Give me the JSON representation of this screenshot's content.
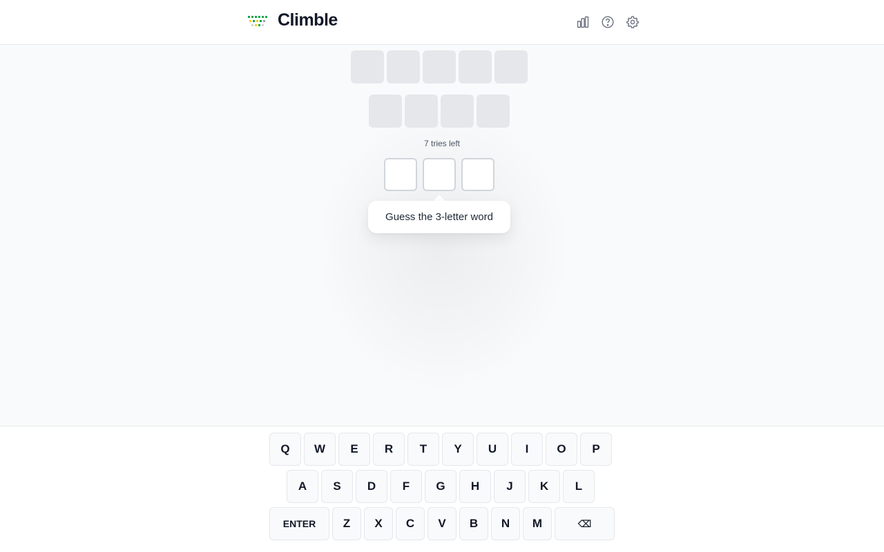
{
  "header": {
    "title": "Climble",
    "logo_icon": "climble-logo-icon",
    "icons": [
      "stats-icon",
      "help-icon",
      "settings-icon"
    ]
  },
  "board": {
    "completed_rows": [
      {
        "length": 5,
        "letters": [
          "",
          "",
          "",
          "",
          ""
        ]
      },
      {
        "length": 4,
        "letters": [
          "",
          "",
          "",
          ""
        ]
      }
    ],
    "tries_left": "7 tries left",
    "current_row": {
      "length": 3,
      "letters": [
        "",
        "",
        ""
      ]
    },
    "hint": "Guess the 3-letter word"
  },
  "keyboard": {
    "row1": [
      "Q",
      "W",
      "E",
      "R",
      "T",
      "Y",
      "U",
      "I",
      "O",
      "P"
    ],
    "row2": [
      "A",
      "S",
      "D",
      "F",
      "G",
      "H",
      "J",
      "K",
      "L"
    ],
    "row3": [
      "Z",
      "X",
      "C",
      "V",
      "B",
      "N",
      "M"
    ],
    "enter_label": "ENTER",
    "backspace_label": "⌫"
  },
  "colors": {
    "locked_tile": "#e5e7eb",
    "logo_green": "#16a34a",
    "logo_yellow": "#facc15"
  }
}
